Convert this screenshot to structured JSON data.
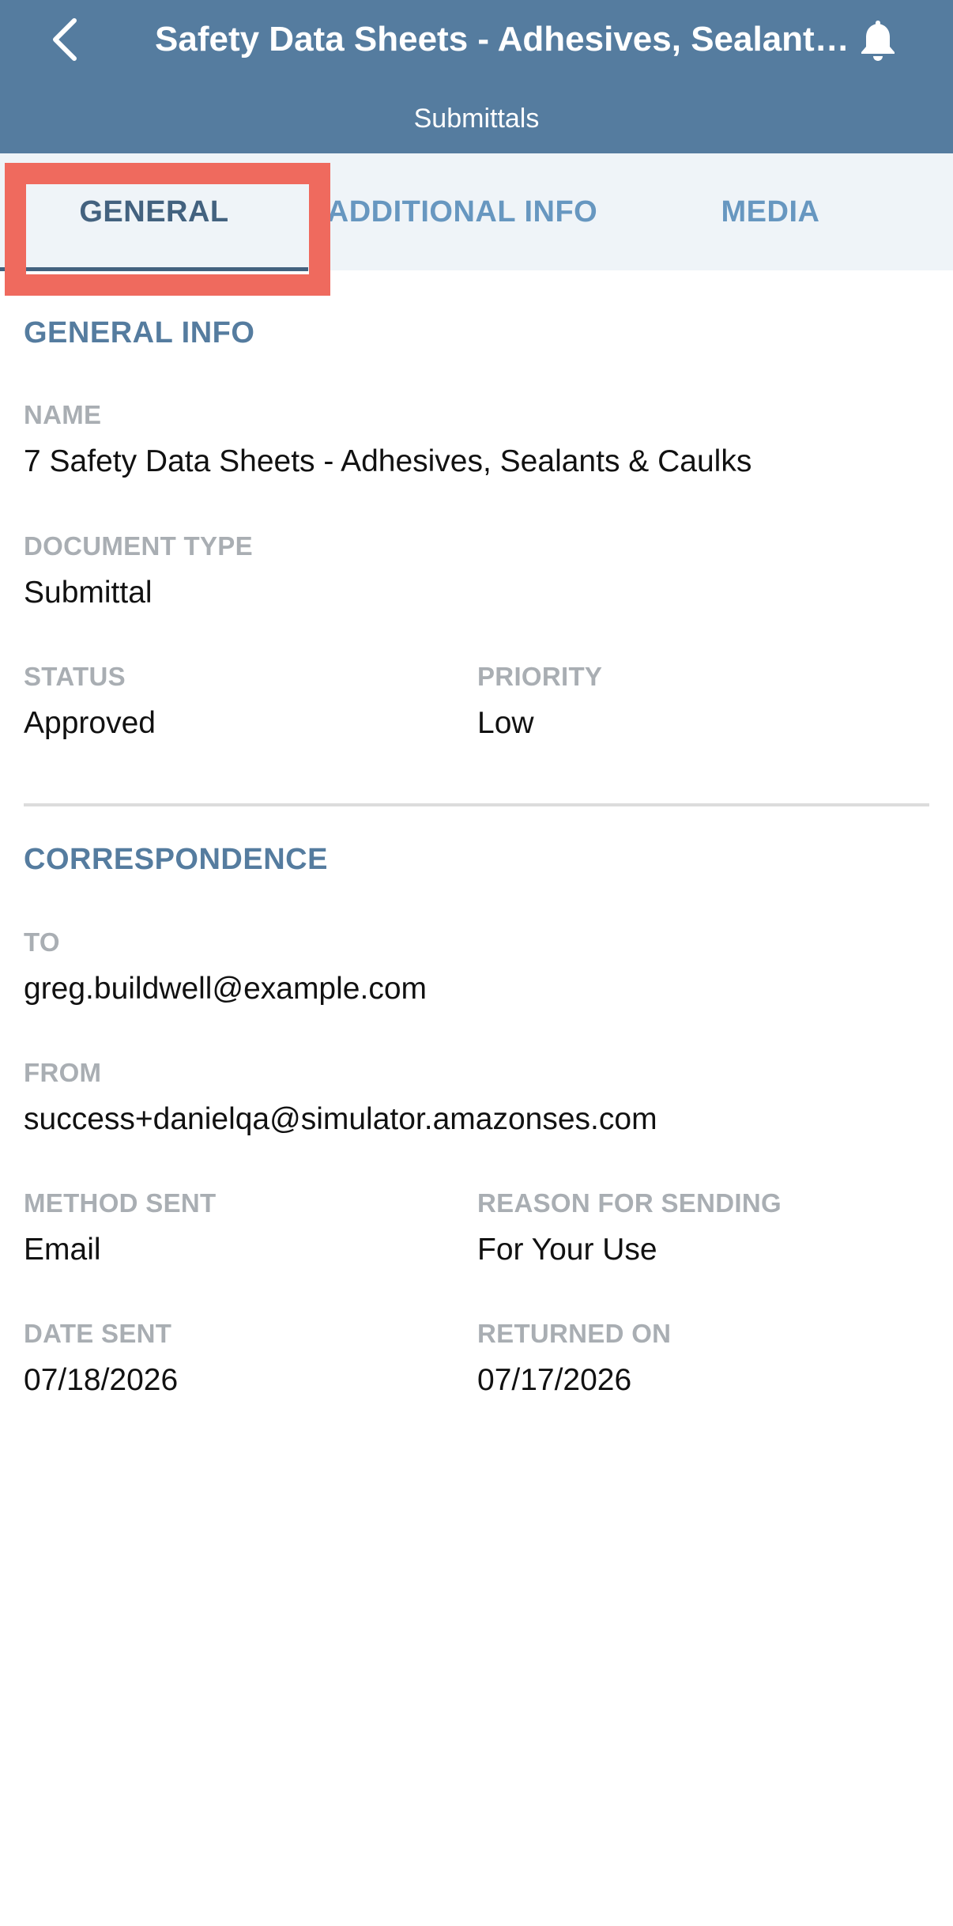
{
  "header": {
    "back_icon": "chevron-left-icon",
    "title": "Safety Data Sheets - Adhesives, Sealants & Caulks",
    "subtitle": "Submittals",
    "bell_icon": "bell-icon",
    "background_color": "#557c9f"
  },
  "tabs": [
    {
      "label": "GENERAL",
      "active": true
    },
    {
      "label": "ADDITIONAL INFO",
      "active": false
    },
    {
      "label": "MEDIA",
      "active": false
    }
  ],
  "highlight_color": "#ef6a5e",
  "general_info": {
    "section_title": "GENERAL INFO",
    "name_label": "NAME",
    "name_value": "7 Safety Data Sheets - Adhesives, Sealants & Caulks",
    "document_type_label": "DOCUMENT TYPE",
    "document_type_value": "Submittal",
    "status_label": "STATUS",
    "status_value": "Approved",
    "priority_label": "PRIORITY",
    "priority_value": "Low"
  },
  "correspondence": {
    "section_title": "CORRESPONDENCE",
    "to_label": "TO",
    "to_value": "greg.buildwell@example.com",
    "from_label": "FROM",
    "from_value": "success+danielqa@simulator.amazonses.com",
    "method_sent_label": "METHOD SENT",
    "method_sent_value": "Email",
    "reason_label": "REASON FOR SENDING",
    "reason_value": "For Your Use",
    "date_sent_label": "DATE SENT",
    "date_sent_value": "07/18/2026",
    "returned_on_label": "RETURNED ON",
    "returned_on_value": "07/17/2026"
  }
}
